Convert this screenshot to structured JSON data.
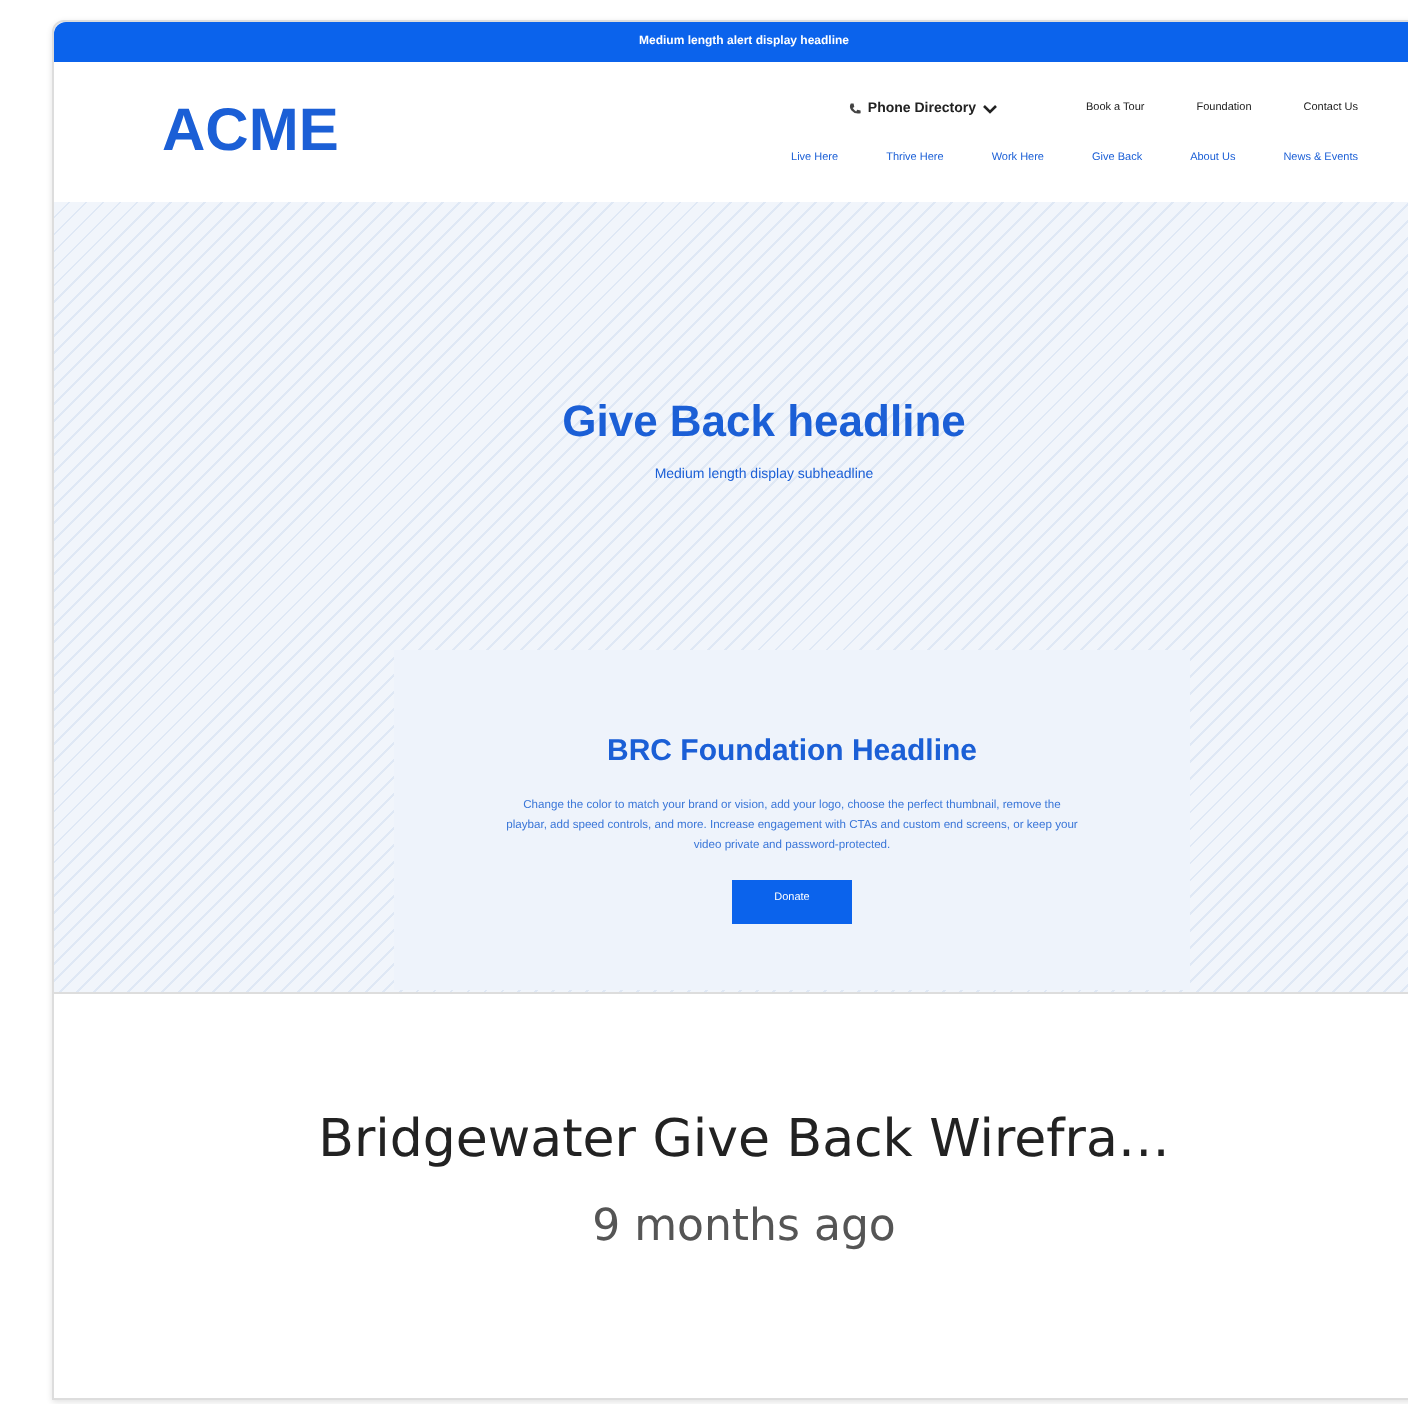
{
  "card": {
    "thumbnail": {
      "alert": "Medium length alert display headline",
      "logo": "ACME",
      "utility_nav": [
        {
          "label": "Phone Directory",
          "kind": "dropdown"
        },
        {
          "label": "Book a Tour",
          "kind": "link"
        },
        {
          "label": "Foundation",
          "kind": "link"
        },
        {
          "label": "Contact Us",
          "kind": "link"
        }
      ],
      "main_nav": [
        "Live Here",
        "Thrive Here",
        "Work Here",
        "Give Back",
        "About Us",
        "News & Events"
      ],
      "hero": {
        "headline": "Give Back headline",
        "subheadline": "Medium length display subheadline"
      },
      "feature": {
        "headline": "BRC Foundation Headline",
        "body": "Change the color to match your brand or vision, add your logo, choose the perfect thumbnail, remove the playbar, add speed controls, and more. Increase engagement with CTAs and custom end screens, or keep your video private and password-protected.",
        "button": "Donate"
      }
    },
    "title": "Bridgewater Give Back Wirefra…",
    "time": "9 months ago"
  }
}
